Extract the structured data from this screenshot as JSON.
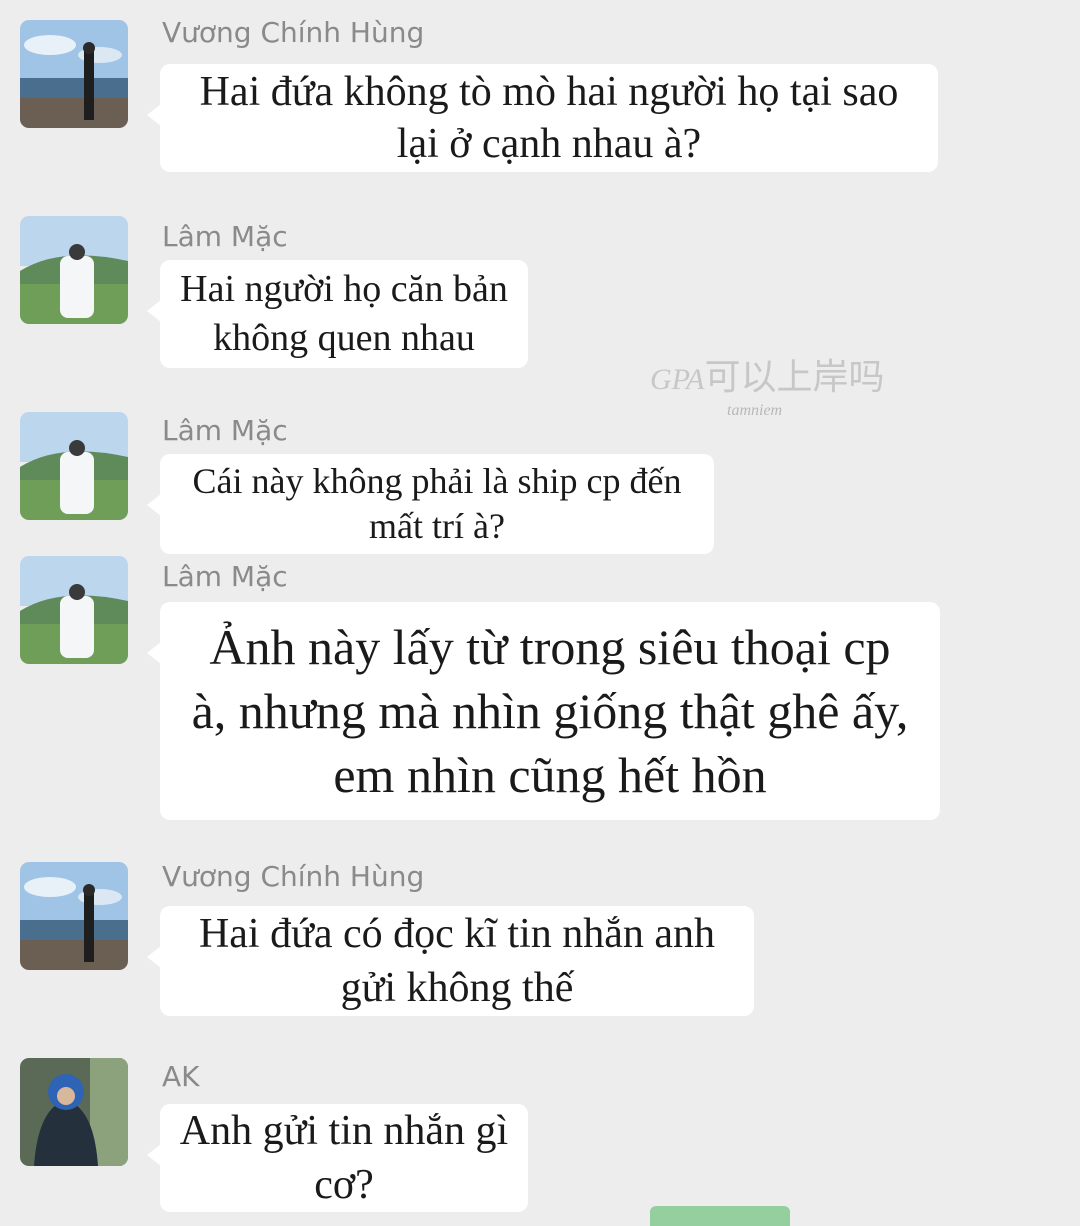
{
  "messages": [
    {
      "sender": "Vương Chính Hùng",
      "avatar": "avatar-vuong-chinh-hung",
      "lines": [
        "Hai đứa không tò mò hai người họ tại sao",
        "lại ở cạnh nhau à?"
      ]
    },
    {
      "sender": "Lâm Mặc",
      "avatar": "avatar-lam-mac",
      "lines": [
        "Hai người họ căn bản",
        "không quen nhau"
      ]
    },
    {
      "sender": "Lâm Mặc",
      "avatar": "avatar-lam-mac",
      "lines": [
        "Cái này không phải là ship cp đến",
        "mất trí à?"
      ]
    },
    {
      "sender": "Lâm Mặc",
      "avatar": "avatar-lam-mac",
      "lines": [
        "Ảnh này lấy từ trong siêu thoại cp",
        "à, nhưng mà nhìn giống thật ghê ấy,",
        "em nhìn cũng hết hồn"
      ]
    },
    {
      "sender": "Vương Chính Hùng",
      "avatar": "avatar-vuong-chinh-hung",
      "lines": [
        "Hai đứa có đọc kĩ tin nhắn anh",
        "gửi không thế"
      ]
    },
    {
      "sender": "AK",
      "avatar": "avatar-ak",
      "lines": [
        "Anh gửi tin nhắn gì",
        "cơ?"
      ]
    }
  ],
  "watermark": {
    "latin": "GPA",
    "cjk": "可以上岸吗",
    "sub": "tamniem"
  },
  "colors": {
    "background": "#ededed",
    "bubble": "#ffffff",
    "sender": "#8a8a8a",
    "accent_green": "#95cf9f"
  }
}
